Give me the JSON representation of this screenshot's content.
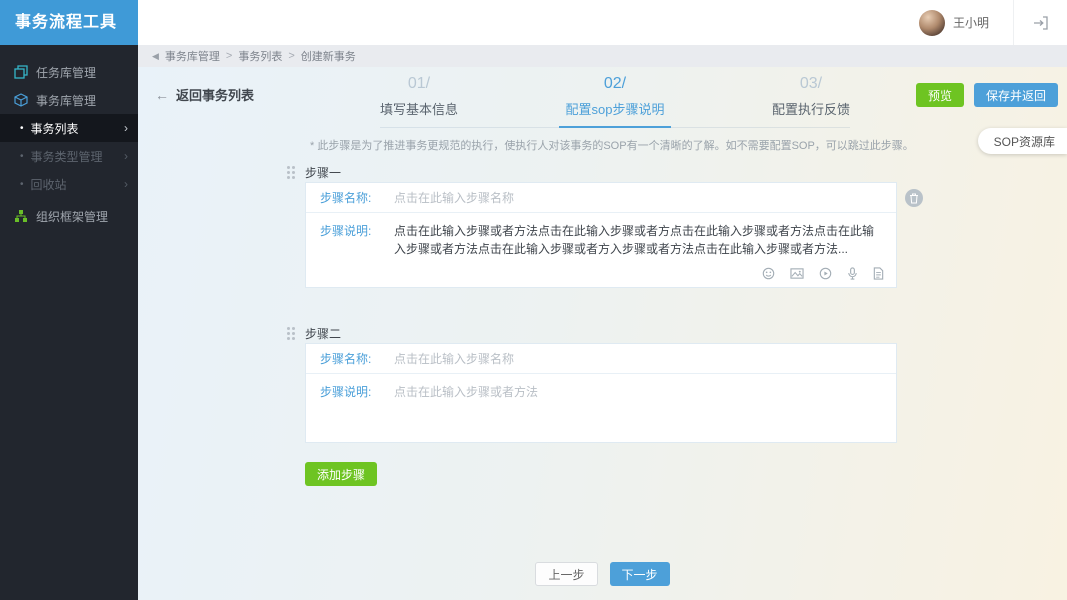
{
  "app": {
    "title": "事务流程工具"
  },
  "topbar": {
    "user_name": "王小明"
  },
  "icons_text": {
    "back_arrow": "←",
    "collapse": "◀",
    "chevron": "›",
    "bullet": "•",
    "sep": ">"
  },
  "sidebar": {
    "task_lib": "任务库管理",
    "affair_lib": "事务库管理",
    "affair_list": "事务列表",
    "affair_type": "事务类型管理",
    "recycle": "回收站",
    "org": "组织框架管理"
  },
  "breadcrumb": {
    "p1": "事务库管理",
    "p2": "事务列表",
    "p3": "创建新事务"
  },
  "header": {
    "back_label": "返回事务列表",
    "preview_label": "预览",
    "save_label": "保存并返回"
  },
  "wizard": {
    "steps": [
      {
        "num": "01/",
        "label": "填写基本信息"
      },
      {
        "num": "02/",
        "label": "配置sop步骤说明"
      },
      {
        "num": "03/",
        "label": "配置执行反馈"
      }
    ]
  },
  "note": "* 此步骤是为了推进事务更规范的执行，使执行人对该事务的SOP有一个清晰的了解。如不需要配置SOP，可以跳过此步骤。",
  "sop_panel_label": "SOP资源库",
  "steps": [
    {
      "title": "步骤一",
      "name_label": "步骤名称:",
      "name_placeholder": "点击在此输入步骤名称",
      "desc_label": "步骤说明:",
      "desc_text": "点击在此输入步骤或者方法点击在此输入步骤或者方点击在此输入步骤或者方法点击在此输入步骤或者方法点击在此输入步骤或者方入步骤或者方法点击在此输入步骤或者方法..."
    },
    {
      "title": "步骤二",
      "name_label": "步骤名称:",
      "name_placeholder": "点击在此输入步骤名称",
      "desc_label": "步骤说明:",
      "desc_placeholder": "点击在此输入步骤或者方法"
    }
  ],
  "actions": {
    "add_step": "添加步骤",
    "prev": "上一步",
    "next": "下一步"
  },
  "colors": {
    "accent_blue": "#4da0d9",
    "accent_green": "#6ec422",
    "sidebar_bg": "#22262e"
  }
}
